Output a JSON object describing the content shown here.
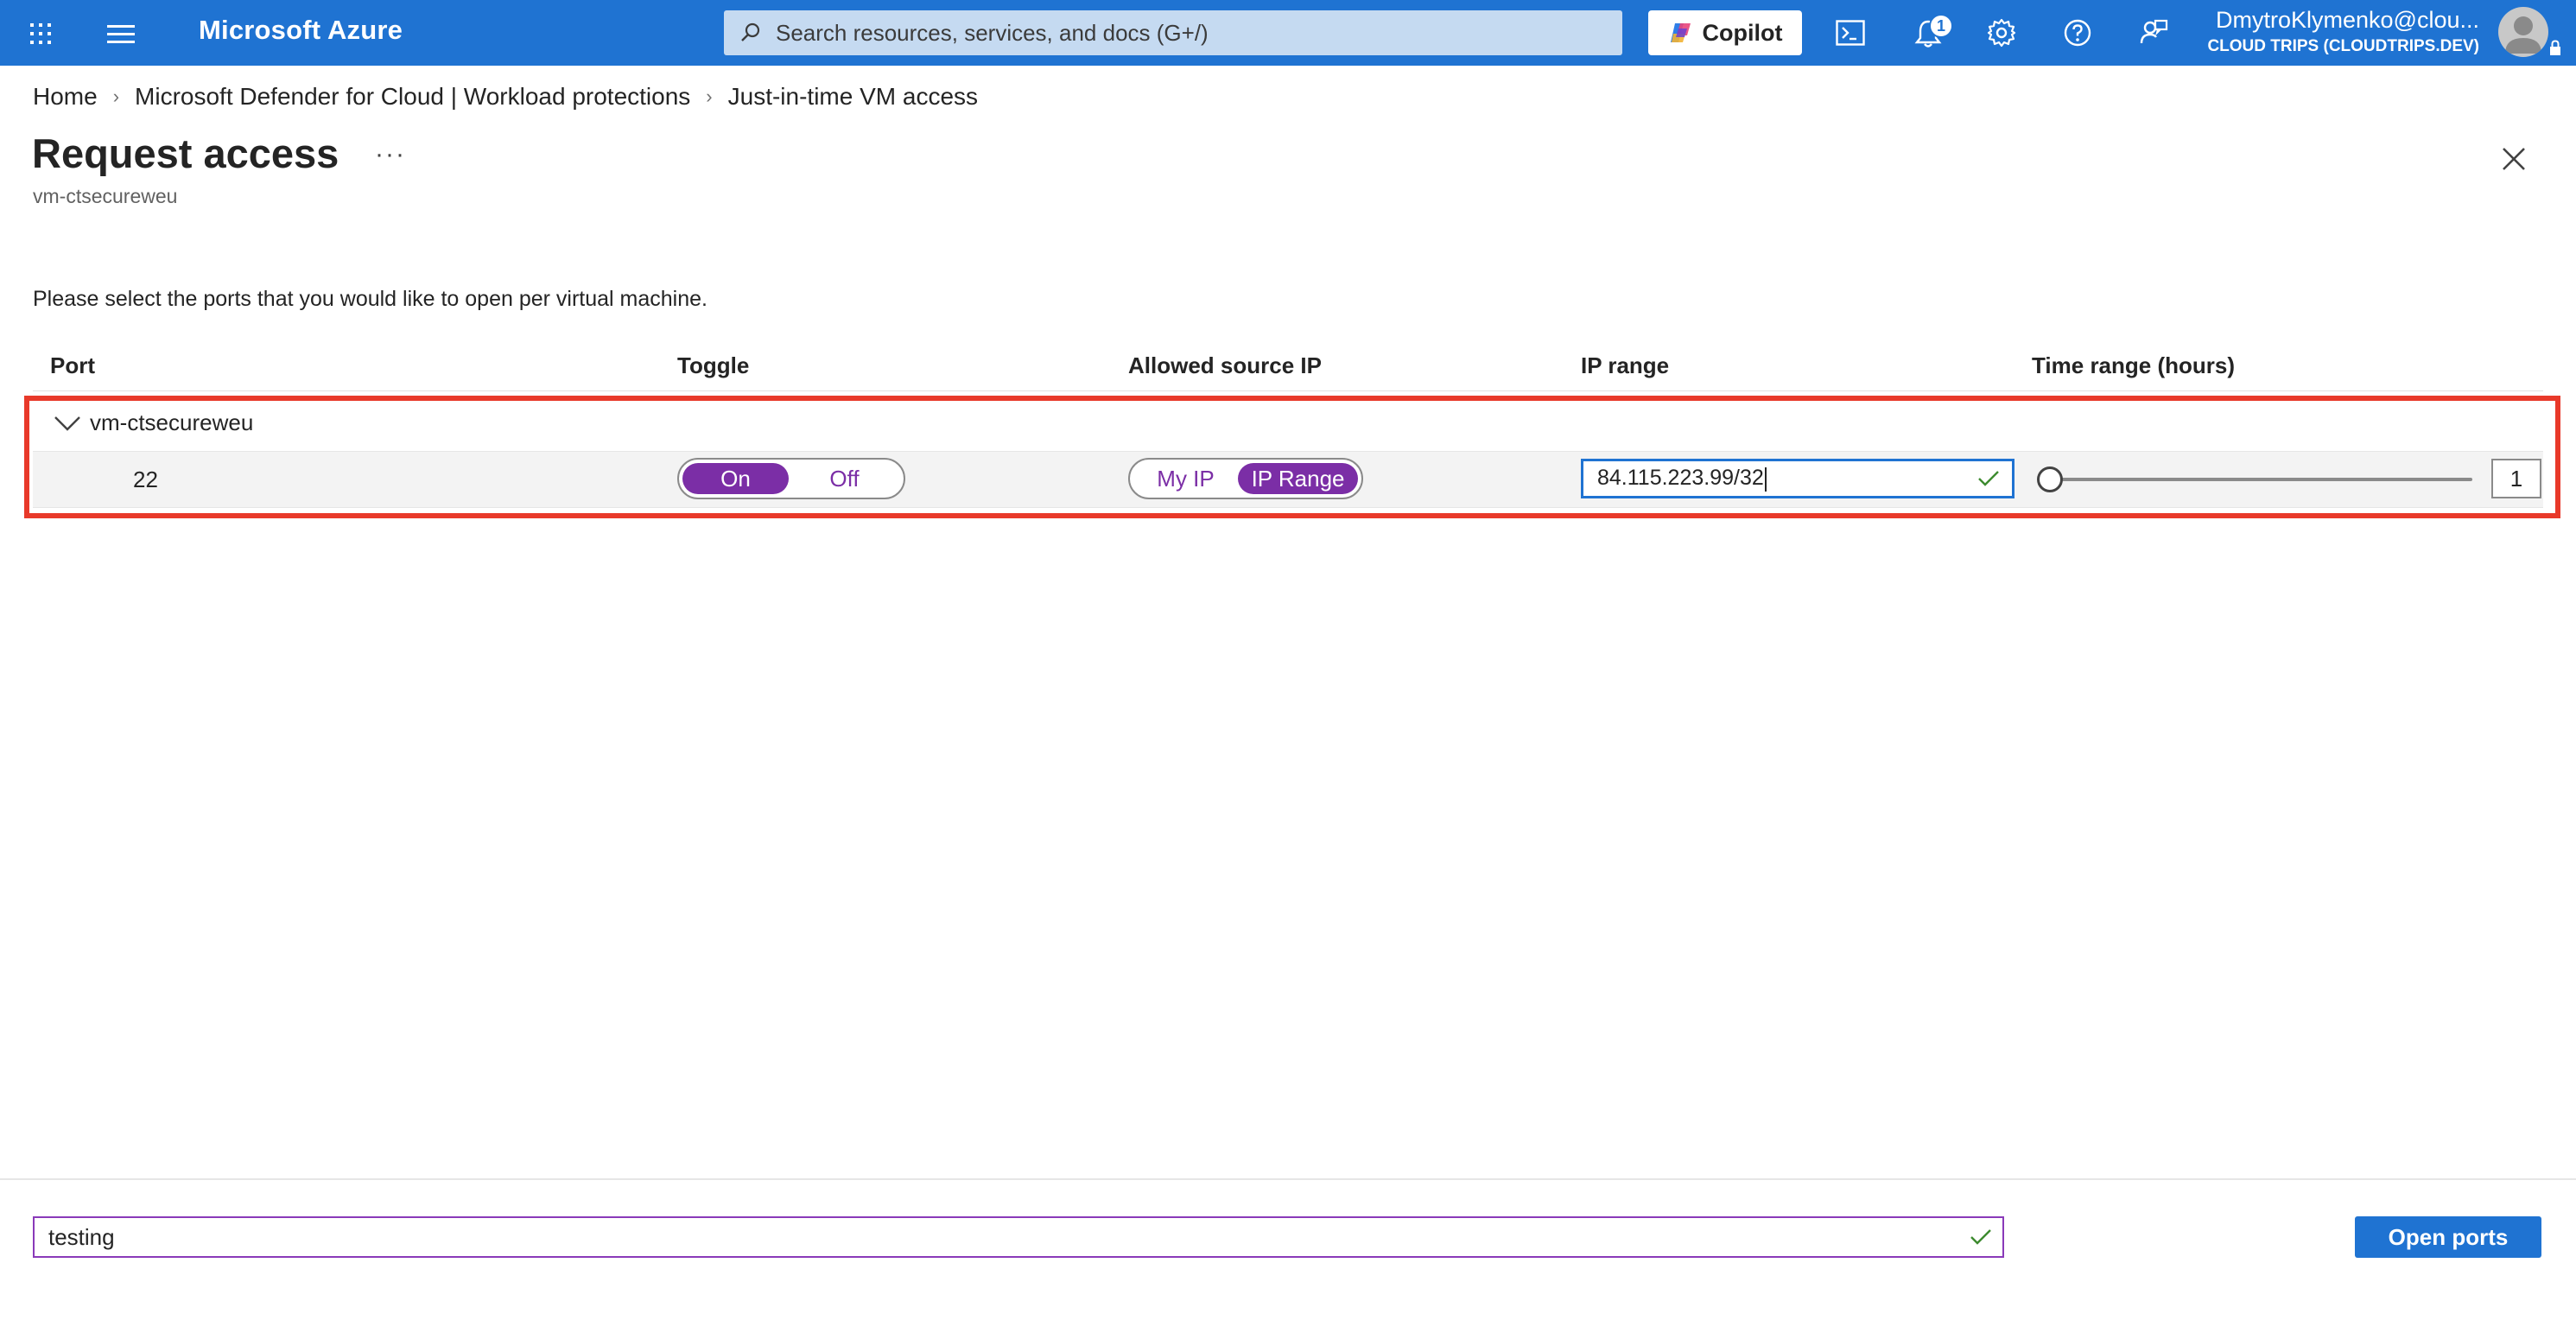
{
  "topbar": {
    "brand": "Microsoft Azure",
    "search_placeholder": "Search resources, services, and docs (G+/)",
    "copilot_label": "Copilot",
    "notification_count": "1",
    "account_name": "DmytroKlymenko@clou...",
    "tenant": "CLOUD TRIPS (CLOUDTRIPS.DEV)",
    "background_color": "#1f73d2"
  },
  "breadcrumb": {
    "items": [
      "Home",
      "Microsoft Defender for Cloud | Workload protections",
      "Just-in-time VM access"
    ]
  },
  "page": {
    "title": "Request access",
    "more_label": "···",
    "subtitle": "vm-ctsecureweu",
    "instructions": "Please select the ports that you would like to open per virtual machine."
  },
  "table": {
    "headers": {
      "port": "Port",
      "toggle": "Toggle",
      "source_ip": "Allowed source IP",
      "ip_range": "IP range",
      "time_range": "Time range (hours)"
    },
    "group_name": "vm-ctsecureweu",
    "rows": [
      {
        "port": "22",
        "toggle_on": "On",
        "toggle_off": "Off",
        "toggle_selected": "On",
        "source_my_ip": "My IP",
        "source_ip_range": "IP Range",
        "source_selected": "IP Range",
        "ip_range_value": "84.115.223.99/32",
        "hours": "1"
      }
    ]
  },
  "footer": {
    "justification_value": "testing",
    "open_ports_label": "Open ports"
  },
  "colors": {
    "accent": "#1f73d2",
    "toggle_selected": "#7b2ea6",
    "highlight_border": "#e8392a"
  }
}
